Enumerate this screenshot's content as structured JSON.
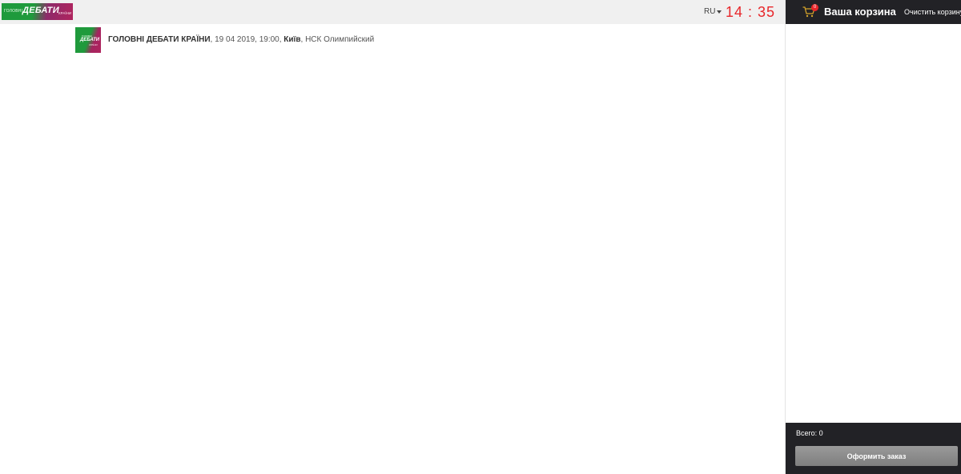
{
  "header": {
    "logo": {
      "top_text": "ГОЛОВНІ",
      "main_text": "ДЕБАТИ",
      "bottom_text": "КРАЇНИ"
    },
    "language": "RU",
    "timer": "14 : 35",
    "colors": {
      "timer": "#e8262a",
      "logo_green": "#1f9a3c",
      "logo_magenta": "#b0245e"
    }
  },
  "event": {
    "thumb": {
      "top_text": "ГОЛОВНІ",
      "main_text": "ДЕБАТИ",
      "bottom_text": "КРАЇНИ"
    },
    "name": "ГОЛОВНІ ДЕБАТИ КРАЇНИ",
    "datetime": ", 19 04 2019, 19:00, ",
    "city": "Київ",
    "venue": ", НСК Олимпийский"
  },
  "cart": {
    "icon": "shopping-cart-icon",
    "badge_count": "0",
    "title": "Ваша корзина",
    "clear_label": "Очистить корзину",
    "total_label": "Всего: 0",
    "checkout_label": "Оформить заказ",
    "colors": {
      "header_bg": "#222226",
      "cart_icon": "#d4a32a",
      "badge": "#e8262a"
    }
  }
}
